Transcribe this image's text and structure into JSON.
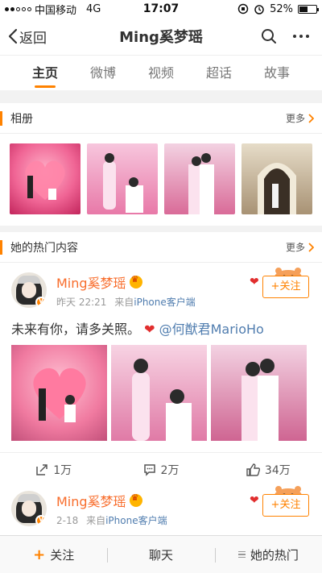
{
  "status_bar": {
    "carrier": "中国移动",
    "network": "4G",
    "time": "17:07",
    "battery": "52%"
  },
  "nav": {
    "back_label": "返回",
    "title": "Ming奚梦瑶"
  },
  "tabs": [
    {
      "label": "主页"
    },
    {
      "label": "微博"
    },
    {
      "label": "视频"
    },
    {
      "label": "超话"
    },
    {
      "label": "故事"
    }
  ],
  "album": {
    "title": "相册",
    "more_label": "更多"
  },
  "hot": {
    "title": "她的热门内容",
    "more_label": "更多"
  },
  "posts": [
    {
      "username": "Ming奚梦瑶",
      "time": "昨天 22:21",
      "source_prefix": "来自",
      "source": "iPhone客户端",
      "follow_label": "+关注",
      "text": "未来有你，请多关照。",
      "mention": "@何猷君MarioHo",
      "reposts": "1万",
      "comments": "2万",
      "likes": "34万"
    },
    {
      "username": "Ming奚梦瑶",
      "time": "2-18",
      "source_prefix": "来自",
      "source": "iPhone客户端",
      "follow_label": "+关注"
    }
  ],
  "bottom_bar": {
    "follow_label": "关注",
    "chat_label": "聊天",
    "hot_label": "她的热门"
  },
  "colors": {
    "accent": "#ff8200",
    "username": "#f86d2c",
    "link": "#507daf"
  }
}
